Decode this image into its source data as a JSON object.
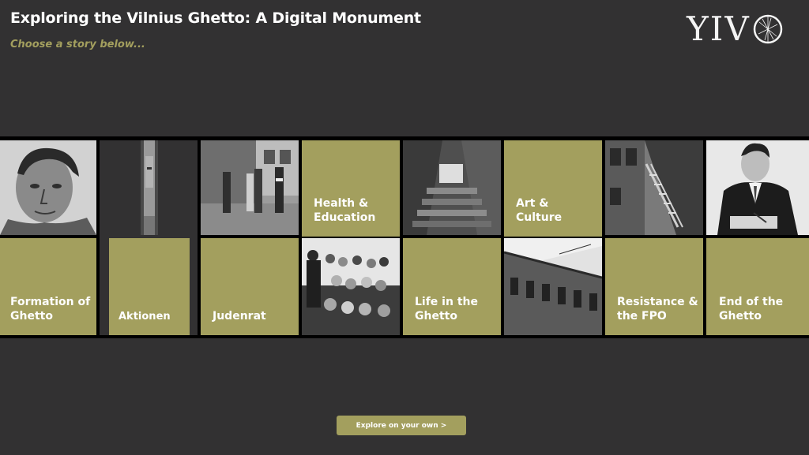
{
  "header": {
    "title": "Exploring the Vilnius Ghetto: A Digital Monument",
    "subtitle": "Choose a story below..."
  },
  "logo": {
    "text": "YIV",
    "o_glyph": "O"
  },
  "stories": [
    {
      "label": "Formation of\nGhetto",
      "photo": "portrait-man-icon"
    },
    {
      "label": "Aktionen",
      "photo": "partial-portrait-icon"
    },
    {
      "label": "Judenrat",
      "photo": "street-guards-icon"
    },
    {
      "label": "Health &\nEducation",
      "photo": "crowd-icon"
    },
    {
      "label": "Life in the\nGhetto",
      "photo": "courtyard-stairs-icon"
    },
    {
      "label": "Art &\nCulture",
      "photo": "building-facade-icon"
    },
    {
      "label": "Resistance &\nthe FPO",
      "photo": "wooden-house-icon"
    },
    {
      "label": "End of the\nGhetto",
      "photo": "man-writing-icon"
    }
  ],
  "explore_button": {
    "label": "Explore on your own >"
  },
  "colors": {
    "background": "#323132",
    "accent": "#a39f5e",
    "strip": "#000000"
  }
}
